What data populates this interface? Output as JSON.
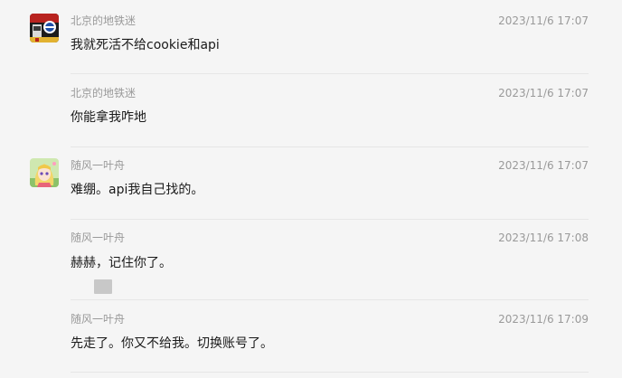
{
  "messages": [
    {
      "sender": "北京的地铁迷",
      "time": "2023/11/6 17:07",
      "text": "我就死活不给cookie和api",
      "avatar_icon": "metro-avatar-icon"
    },
    {
      "sender": "北京的地铁迷",
      "time": "2023/11/6 17:07",
      "text": "你能拿我咋地"
    },
    {
      "sender": "随风一叶舟",
      "time": "2023/11/6 17:07",
      "text": "难绷。api我自己找的。",
      "avatar_icon": "anime-girl-avatar-icon"
    },
    {
      "sender": "随风一叶舟",
      "time": "2023/11/6 17:08",
      "text": "赫赫，记住你了。",
      "attachment_icon": "image-thumbnail-icon"
    },
    {
      "sender": "随风一叶舟",
      "time": "2023/11/6 17:09",
      "text": "先走了。你又不给我。切换账号了。"
    }
  ],
  "colors": {
    "background": "#f5f5f5",
    "meta_text": "#9a9a9a",
    "body_text": "#1a1a1a",
    "divider": "#e6e6e6"
  }
}
